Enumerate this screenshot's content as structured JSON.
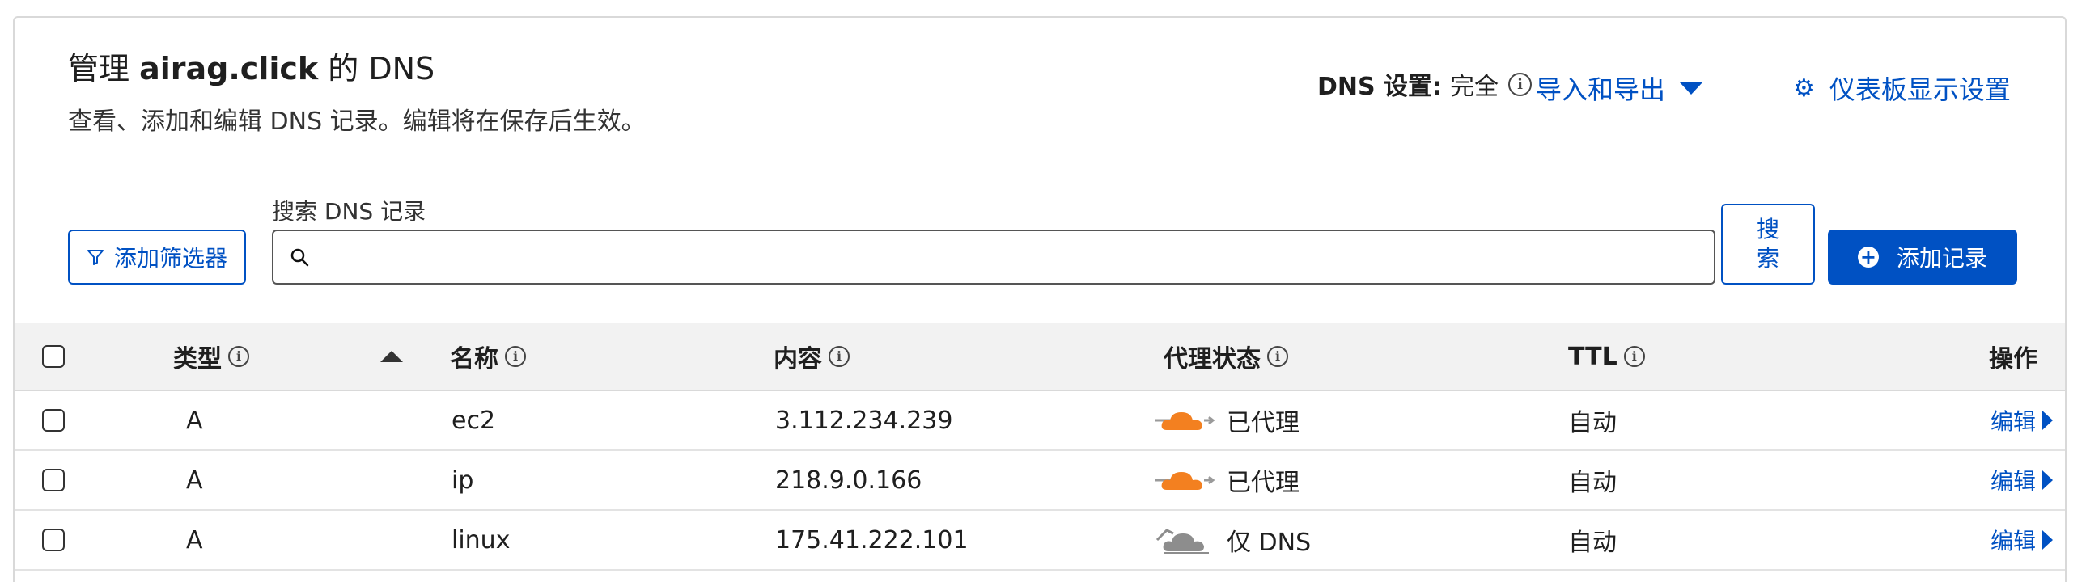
{
  "header": {
    "title_prefix": "管理",
    "domain": "airag.click",
    "title_suffix": "的 DNS",
    "subtitle": "查看、添加和编辑 DNS 记录。编辑将在保存后生效。",
    "dns_setting_label": "DNS 设置:",
    "dns_setting_value": "完全",
    "import_export": "导入和导出",
    "dashboard_settings": "仪表板显示设置"
  },
  "toolbar": {
    "filter_button": "添加筛选器",
    "search_label": "搜索 DNS 记录",
    "search_placeholder": "",
    "search_button_line1": "搜",
    "search_button_line2": "索",
    "add_record_button": "添加记录"
  },
  "table": {
    "columns": {
      "type": "类型",
      "name": "名称",
      "content": "内容",
      "proxy": "代理状态",
      "ttl": "TTL",
      "actions": "操作"
    },
    "rows": [
      {
        "type": "A",
        "name": "ec2",
        "content": "3.112.234.239",
        "proxy": "已代理",
        "proxied": true,
        "ttl": "自动",
        "edit": "编辑"
      },
      {
        "type": "A",
        "name": "ip",
        "content": "218.9.0.166",
        "proxy": "已代理",
        "proxied": true,
        "ttl": "自动",
        "edit": "编辑"
      },
      {
        "type": "A",
        "name": "linux",
        "content": "175.41.222.101",
        "proxy": "仅 DNS",
        "proxied": false,
        "ttl": "自动",
        "edit": "编辑"
      }
    ]
  },
  "colors": {
    "accent": "#0051c3",
    "proxy_orange": "#f38020",
    "dns_only_gray": "#8d8d8d"
  },
  "icons": {
    "filter": "filter-icon",
    "search": "search-icon",
    "info": "info-icon",
    "gear": "gear-icon",
    "caret_down": "caret-down-icon",
    "plus": "plus-circle-icon",
    "sort": "sort-up-icon",
    "proxied_cloud": "orange-cloud-icon",
    "dns_only_cloud": "gray-cloud-icon",
    "caret_right": "caret-right-icon"
  }
}
